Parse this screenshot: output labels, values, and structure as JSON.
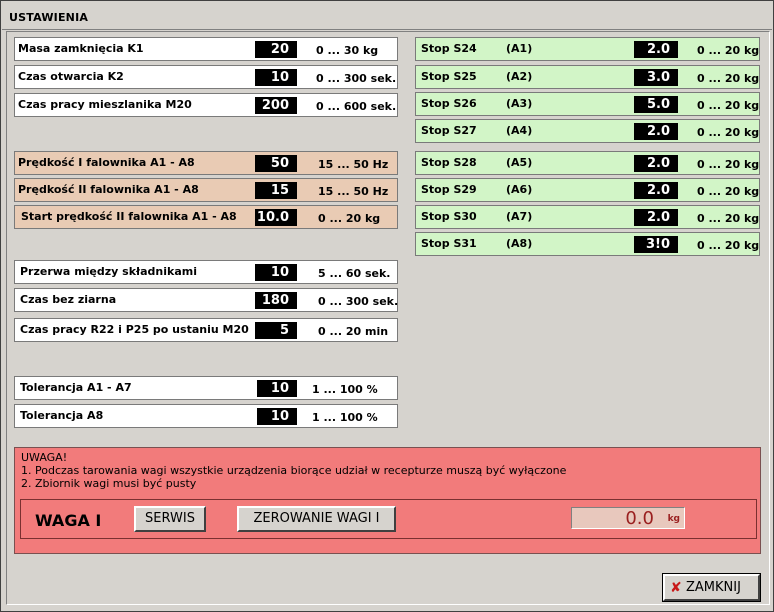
{
  "window": {
    "title": "USTAWIENIA"
  },
  "left_rows": [
    {
      "label": "Masa zamknięcia K1",
      "value": "20",
      "range": "0 ... 30 kg"
    },
    {
      "label": "Czas otwarcia K2",
      "value": "10",
      "range": "0 ... 300 sek."
    },
    {
      "label": "Czas pracy mieszlanika M20",
      "value": "200",
      "range": "0 ... 600 sek."
    },
    {
      "label": "Prędkość I falownika A1 - A8",
      "value": "50",
      "range": "15 ... 50 Hz"
    },
    {
      "label": "Prędkość II falownika A1 - A8",
      "value": "15",
      "range": "15 ... 50 Hz"
    },
    {
      "label": "Start prędkość II falownika A1 - A8",
      "value": "10.0",
      "range": "0 ... 20 kg"
    },
    {
      "label": "Przerwa między składnikami",
      "value": "10",
      "range": "5 ... 60 sek."
    },
    {
      "label": "Czas bez ziarna",
      "value": "180",
      "range": "0 ... 300 sek."
    },
    {
      "label": "Czas pracy R22 i P25 po ustaniu M20",
      "value": "5",
      "range": "0 ... 20 min"
    },
    {
      "label": "Tolerancja A1 - A7",
      "value": "10",
      "range": "1 ... 100 %"
    },
    {
      "label": "Tolerancja A8",
      "value": "10",
      "range": "1 ... 100 %"
    }
  ],
  "right_rows": [
    {
      "label": "Stop S24",
      "sub": "(A1)",
      "value": "2.0",
      "range": "0 ... 20 kg"
    },
    {
      "label": "Stop S25",
      "sub": "(A2)",
      "value": "3.0",
      "range": "0 ... 20 kg"
    },
    {
      "label": "Stop S26",
      "sub": "(A3)",
      "value": "5.0",
      "range": "0 ... 20 kg"
    },
    {
      "label": "Stop S27",
      "sub": "(A4)",
      "value": "2.0",
      "range": "0 ... 20 kg"
    },
    {
      "label": "Stop S28",
      "sub": "(A5)",
      "value": "2.0",
      "range": "0 ... 20 kg"
    },
    {
      "label": "Stop S29",
      "sub": "(A6)",
      "value": "2.0",
      "range": "0 ... 20 kg"
    },
    {
      "label": "Stop S30",
      "sub": "(A7)",
      "value": "2.0",
      "range": "0 ... 20 kg"
    },
    {
      "label": "Stop S31",
      "sub": "(A8)",
      "value": "3!0",
      "range": "0 ... 20 kg"
    }
  ],
  "warning": {
    "heading": "UWAGA!",
    "line1": "1. Podczas tarowania wagi wszystkie urządzenia biorące udział w recepturze muszą być wyłączone",
    "line2": "2. Zbiornik wagi musi być pusty"
  },
  "scale": {
    "title": "WAGA I",
    "service_label": "SERWIS",
    "zero_label": "ZEROWANIE WAGI I",
    "weight_value": "0.0",
    "weight_unit": "kg"
  },
  "footer": {
    "close_label": "ZAMKNIJ",
    "close_icon": "close-x-icon"
  },
  "colors": {
    "white_row": "#ffffff",
    "tan_row": "#e9cbb4",
    "green_row": "#d2f5c7",
    "warning_bg": "#f27b7b",
    "weight_text": "#9a1f1f",
    "close_icon": "#c81818"
  }
}
